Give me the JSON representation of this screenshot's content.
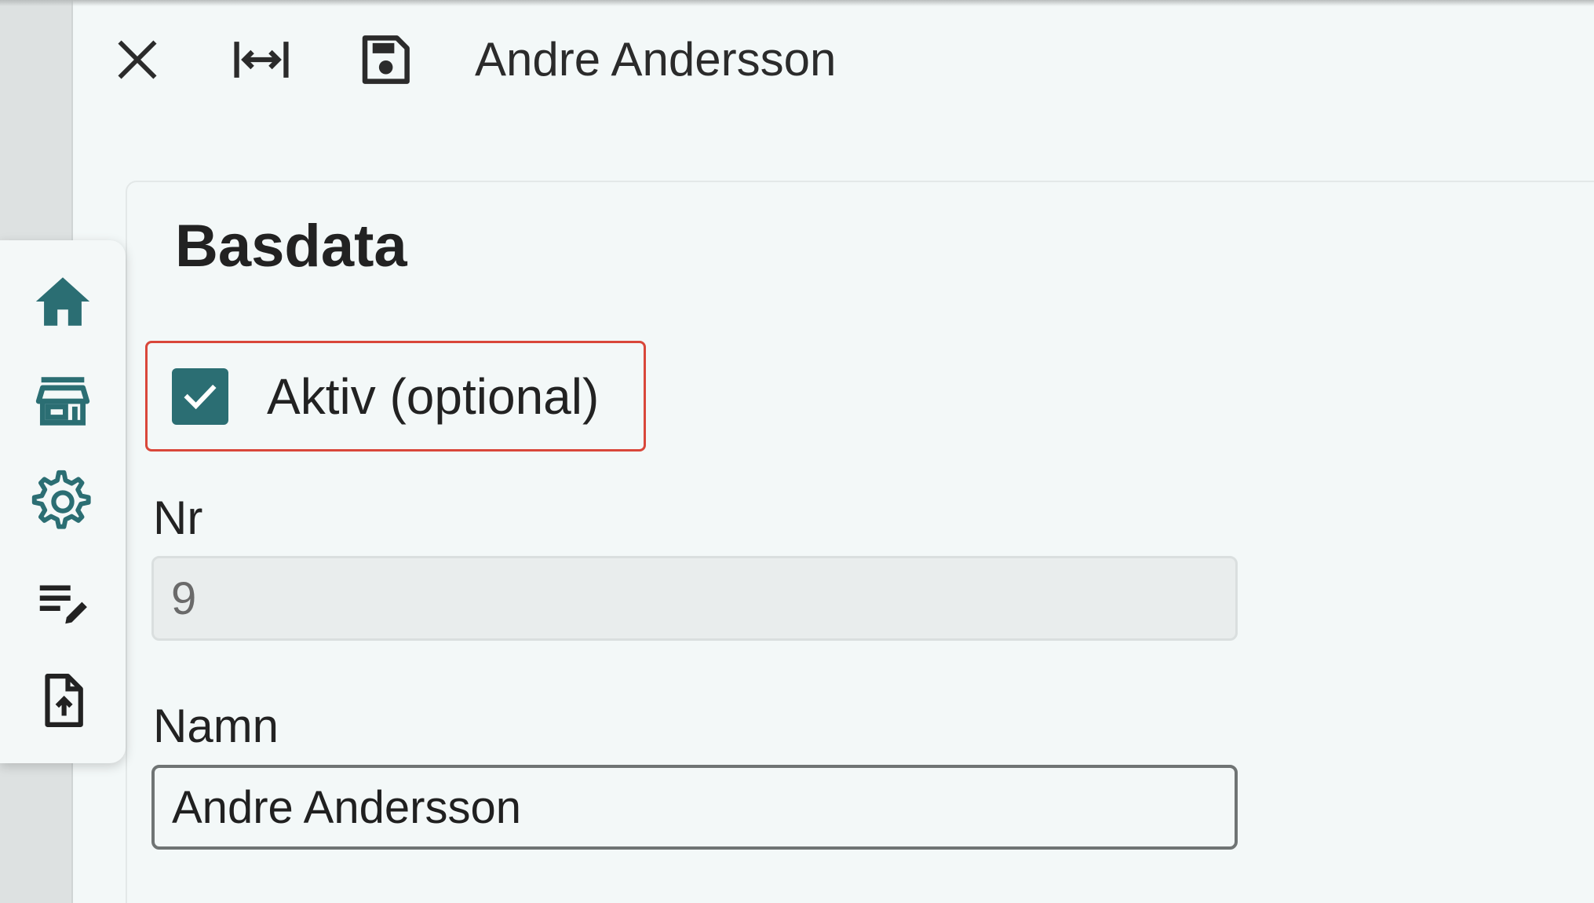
{
  "toolbar": {
    "close_icon": "close-icon",
    "expand_icon": "expand-width-icon",
    "save_icon": "save-icon",
    "title": "Andre Andersson"
  },
  "rail": {
    "items": [
      {
        "icon": "home-icon"
      },
      {
        "icon": "store-icon"
      },
      {
        "icon": "gear-icon"
      },
      {
        "icon": "edit-list-icon"
      },
      {
        "icon": "file-upload-icon"
      }
    ]
  },
  "form": {
    "section_title": "Basdata",
    "aktiv": {
      "label": "Aktiv (optional)",
      "checked": true
    },
    "nr": {
      "label": "Nr",
      "value": "9"
    },
    "namn": {
      "label": "Namn",
      "value": "Andre Andersson"
    }
  },
  "colors": {
    "accent": "#2b6e73",
    "highlight_border": "#d9473a",
    "background": "#f3f8f8"
  }
}
